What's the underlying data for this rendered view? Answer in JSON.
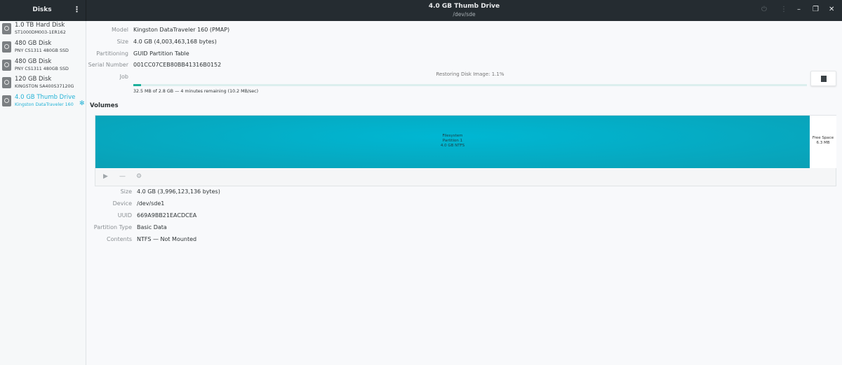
{
  "header": {
    "app_title": "Disks",
    "title": "4.0 GB Thumb Drive",
    "subtitle": "/dev/sde"
  },
  "devices": [
    {
      "name": "1.0 TB Hard Disk",
      "model": "ST1000DM003-1ER162"
    },
    {
      "name": "480 GB Disk",
      "model": "PNY CS1311 480GB SSD"
    },
    {
      "name": "480 GB Disk",
      "model": "PNY CS1311 480GB SSD"
    },
    {
      "name": "120 GB Disk",
      "model": "KINGSTON SA400S37120G"
    },
    {
      "name": "4.0 GB Thumb Drive",
      "model": "Kingston DataTraveler 160",
      "selected": true
    }
  ],
  "drive": {
    "model_label": "Model",
    "model": "Kingston DataTraveler 160 (PMAP)",
    "size_label": "Size",
    "size": "4.0 GB (4,003,463,168 bytes)",
    "partitioning_label": "Partitioning",
    "partitioning": "GUID Partition Table",
    "serial_label": "Serial Number",
    "serial": "001CC07CEB80BB41316B0152",
    "job_label": "Job",
    "job_title": "Restoring Disk Image: 1.1%",
    "job_progress_percent": 1.1,
    "job_detail": "32.5 MB of 2.8 GB — 4 minutes remaining (10.2 MB/sec)"
  },
  "volumes": {
    "heading": "Volumes",
    "partition": {
      "line1": "Filesystem",
      "line2": "Partition 1",
      "line3": "4.0 GB NTFS"
    },
    "free": {
      "line1": "Free Space",
      "line2": "6.3 MB"
    }
  },
  "partition": {
    "size_label": "Size",
    "size": "4.0 GB (3,996,123,136 bytes)",
    "device_label": "Device",
    "device": "/dev/sde1",
    "uuid_label": "UUID",
    "uuid": "669A9BB21EACDCEA",
    "type_label": "Partition Type",
    "type": "Basic Data",
    "contents_label": "Contents",
    "contents": "NTFS — Not Mounted"
  },
  "colors": {
    "accent": "#22b2d6",
    "partition": "#00b7d3",
    "progress": "#1eb09c",
    "header": "#252c31"
  }
}
